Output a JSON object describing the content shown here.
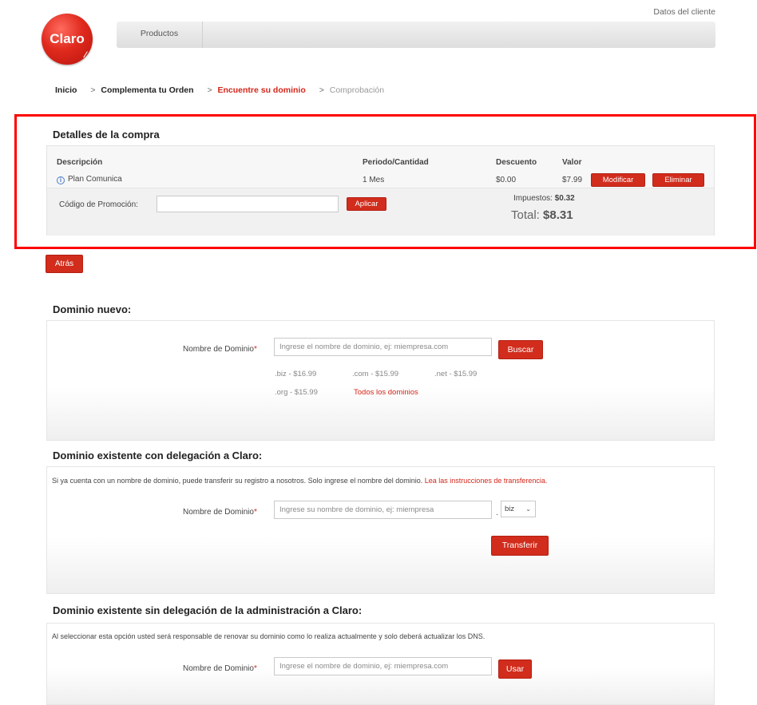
{
  "header": {
    "logo_text": "Claro",
    "nav_item": "Productos",
    "client_link": "Datos del cliente"
  },
  "breadcrumb": {
    "step1": "Inicio",
    "step2": "Complementa tu Orden",
    "step3": "Encuentre su dominio",
    "step4": "Comprobación",
    "separator": ">"
  },
  "purchase": {
    "title": "Detalles de la compra",
    "columns": {
      "description": "Descripción",
      "period": "Periodo/Cantidad",
      "discount": "Descuento",
      "value": "Valor"
    },
    "item": {
      "name": "Plan Comunica",
      "period": "1 Mes",
      "discount": "$0.00",
      "value": "$7.99",
      "modify_label": "Modificar",
      "delete_label": "Eliminar"
    },
    "promo_label": "Código de Promoción:",
    "promo_value": "",
    "apply_label": "Aplicar",
    "taxes_label": "Impuestos:",
    "taxes_value": "$0.32",
    "total_label": "Total:",
    "total_value": "$8.31"
  },
  "back_label": "Atrás",
  "new_domain": {
    "title": "Dominio nuevo:",
    "field_label": "Nombre de Dominio",
    "required_mark": "*",
    "placeholder": "Ingrese el nombre de dominio, ej: miempresa.com",
    "search_label": "Buscar",
    "prices": [
      ".biz - $16.99",
      ".com - $15.99",
      ".net - $15.99",
      ".org - $15.99"
    ],
    "all_domains_link": "Todos los dominios"
  },
  "transfer_domain": {
    "title": "Dominio existente con delegación a Claro:",
    "intro": "Si ya cuenta con un nombre de dominio, puede transferir su registro a nosotros. Solo ingrese el nombre del dominio.",
    "instructions_link": "Lea las instrucciones de transferencia.",
    "field_label": "Nombre de Dominio",
    "required_mark": "*",
    "placeholder": "Ingrese su nombre de dominio, ej: miempresa",
    "dot": ".",
    "tld_selected": "biz",
    "transfer_label": "Transferir"
  },
  "existing_domain": {
    "title": "Dominio existente sin delegación de la administración a Claro:",
    "intro": "Al seleccionar esta opción usted será responsable de renovar su dominio como lo realiza actualmente y solo deberá actualizar los DNS.",
    "field_label": "Nombre de Dominio",
    "required_mark": "*",
    "placeholder": "Ingrese el nombre de dominio, ej: miempresa.com",
    "use_label": "Usar"
  },
  "colors": {
    "brand_red": "#d12c1c",
    "highlight_red": "#ff0000",
    "link_red": "#d3261a"
  }
}
